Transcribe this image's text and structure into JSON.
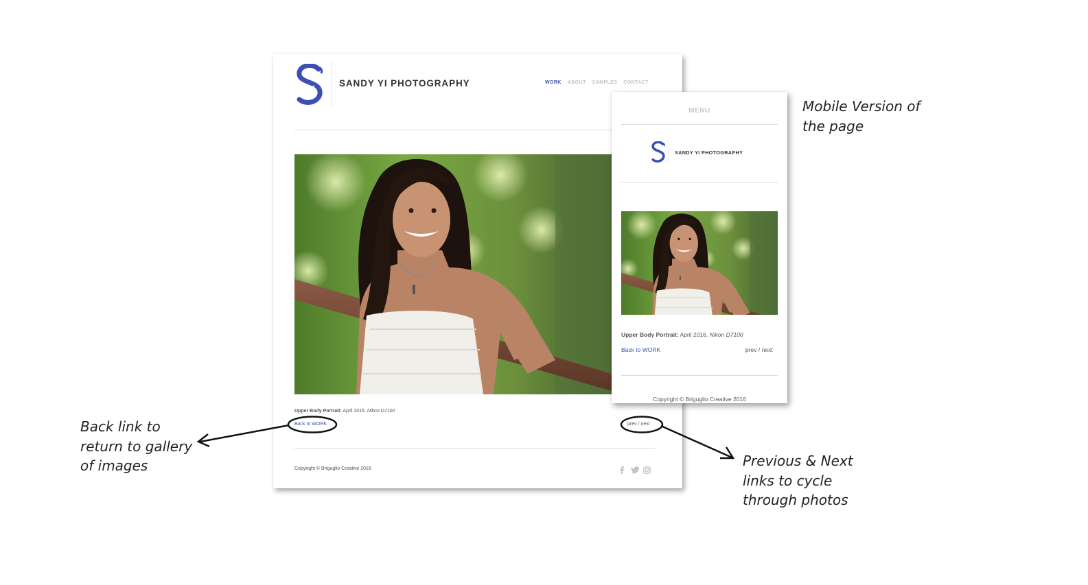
{
  "desktop": {
    "brand": "SANDY YI PHOTOGRAPHY",
    "nav": [
      "WORK",
      "ABOUT",
      "SAMPLES",
      "CONTACT"
    ],
    "nav_active": "WORK",
    "caption_title": "Upper Body Portrait:",
    "caption_date": " April 2016, ",
    "caption_camera": "Nikon D7100",
    "back_link": "Back to WORK",
    "prev_next": "prev / next",
    "copyright": "Copyright © Briguglio Creative 2016",
    "social_icons": [
      "facebook-icon",
      "twitter-icon",
      "instagram-icon"
    ]
  },
  "mobile": {
    "menu": "MENU",
    "brand": "SANDY YI PHOTOGRAPHY",
    "caption_title": "Upper Body Portrait:",
    "caption_date": " April 2016, ",
    "caption_camera": "Nikon D7100",
    "back_link": "Back to WORK",
    "prev_next": "prev / next",
    "copyright": "Copyright © Briguglio Creative 2016"
  },
  "annotations": {
    "back": [
      "Back link to",
      "return to gallery",
      "of images"
    ],
    "prev_next": [
      "Previous & Next",
      "links to cycle",
      "through photos"
    ],
    "mobile": [
      "Mobile Version of",
      "the page"
    ]
  },
  "colors": {
    "accent": "#3b4fb5",
    "nav_inactive": "#c2c2c2",
    "rule": "#dcdcdc"
  }
}
